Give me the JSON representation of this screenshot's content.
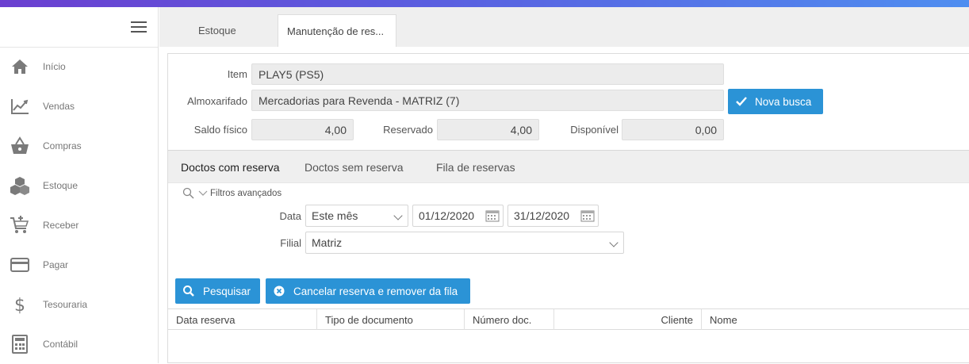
{
  "sidebar": {
    "items": [
      {
        "label": "Início",
        "icon": "home-icon"
      },
      {
        "label": "Vendas",
        "icon": "chart-line-icon"
      },
      {
        "label": "Compras",
        "icon": "basket-icon"
      },
      {
        "label": "Estoque",
        "icon": "boxes-icon"
      },
      {
        "label": "Receber",
        "icon": "cart-plus-icon"
      },
      {
        "label": "Pagar",
        "icon": "credit-card-icon"
      },
      {
        "label": "Tesouraria",
        "icon": "dollar-icon"
      },
      {
        "label": "Contábil",
        "icon": "calculator-icon"
      }
    ]
  },
  "tabs": [
    {
      "label": "Estoque"
    },
    {
      "label": "Manutenção de res..."
    }
  ],
  "form": {
    "item_label": "Item",
    "item_value": "PLAY5 (PS5)",
    "almox_label": "Almoxarifado",
    "almox_value": "Mercadorias para Revenda - MATRIZ (7)",
    "nova_busca": "Nova busca",
    "saldo_label": "Saldo físico",
    "saldo_value": "4,00",
    "reservado_label": "Reservado",
    "reservado_value": "4,00",
    "disponivel_label": "Disponível",
    "disponivel_value": "0,00"
  },
  "subtabs": [
    {
      "label": "Doctos com reserva"
    },
    {
      "label": "Doctos sem reserva"
    },
    {
      "label": "Fila de reservas"
    }
  ],
  "filters": {
    "toggle_label": "Filtros avançados",
    "data_label": "Data",
    "period_value": "Este mês",
    "date_from": "01/12/2020",
    "date_to": "31/12/2020",
    "filial_label": "Filial",
    "filial_value": "Matriz"
  },
  "actions": {
    "pesquisar": "Pesquisar",
    "cancelar": "Cancelar reserva e remover da fila"
  },
  "table": {
    "columns": [
      "Data reserva",
      "Tipo de documento",
      "Número doc.",
      "Cliente",
      "Nome"
    ]
  },
  "colors": {
    "accent": "#2b93d6",
    "gradient_start": "#6b3fd0",
    "gradient_end": "#4f8ef0"
  }
}
